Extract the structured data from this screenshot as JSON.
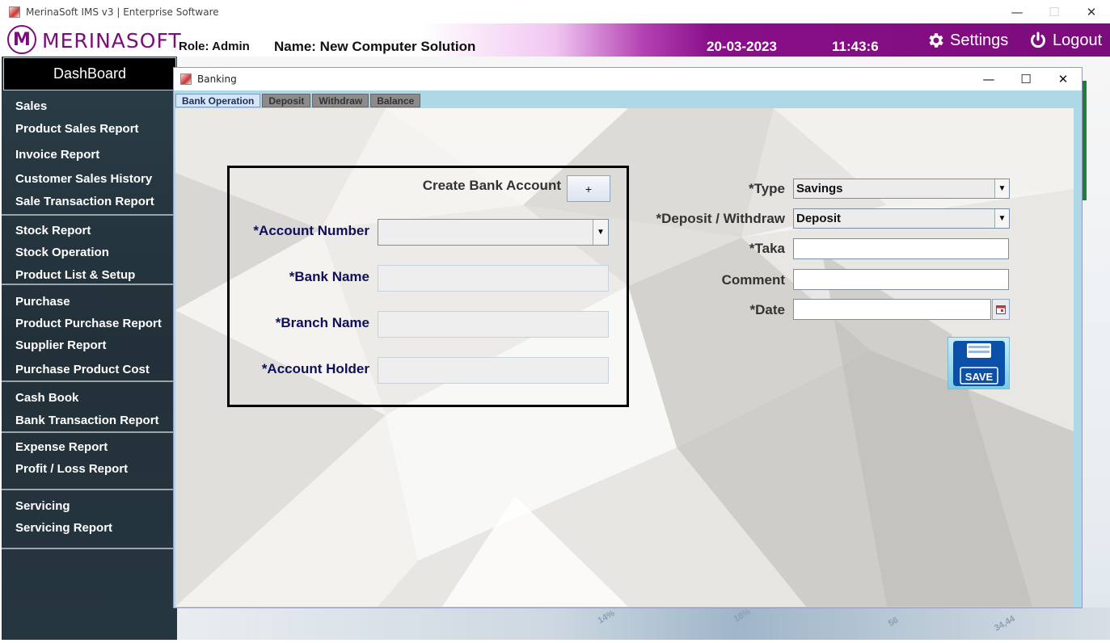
{
  "window": {
    "title": "MerinaSoft IMS v3 | Enterprise Software",
    "minimize": "—",
    "maximize": "☐",
    "close": "✕"
  },
  "header": {
    "logo_letter": "M",
    "logo_text": "MERINASOFT",
    "role": "Role: Admin",
    "name": "Name: New Computer Solution",
    "date": "20-03-2023",
    "time": "11:43:6",
    "settings_label": "Settings",
    "logout_label": "Logout"
  },
  "sidebar": {
    "dashboard_label": "DashBoard",
    "items": [
      "Sales",
      "Product Sales Report",
      "Invoice Report",
      "Customer Sales History",
      "Sale Transaction Report",
      "Stock Report",
      "Stock Operation",
      "Product List & Setup",
      "Purchase",
      "Product Purchase Report",
      "Supplier Report",
      "Purchase Product Cost",
      "Cash Book",
      "Bank Transaction Report",
      "Expense Report",
      "Profit / Loss Report",
      "Servicing",
      "Servicing Report"
    ]
  },
  "banking": {
    "title": "Banking",
    "minimize": "—",
    "maximize": "☐",
    "close": "✕",
    "tabs": [
      "Bank Operation",
      "Deposit",
      "Withdraw",
      "Balance"
    ],
    "create_account_label": "Create Bank Account",
    "create_account_button": "+",
    "account_number_label": "*Account Number",
    "account_number_value": "",
    "bank_name_label": "*Bank Name",
    "bank_name_value": "",
    "branch_name_label": "*Branch Name",
    "branch_name_value": "",
    "account_holder_label": "*Account Holder",
    "account_holder_value": "",
    "type_label": "*Type",
    "type_value": "Savings",
    "deposit_withdraw_label": "*Deposit / Withdraw",
    "deposit_withdraw_value": "Deposit",
    "taka_label": "*Taka",
    "taka_value": "",
    "comment_label": "Comment",
    "comment_value": "",
    "date_label": "*Date",
    "date_value": "",
    "save_label": "SAVE"
  },
  "background": {
    "labels": [
      "14%",
      "18%",
      "56",
      "34,44"
    ]
  }
}
